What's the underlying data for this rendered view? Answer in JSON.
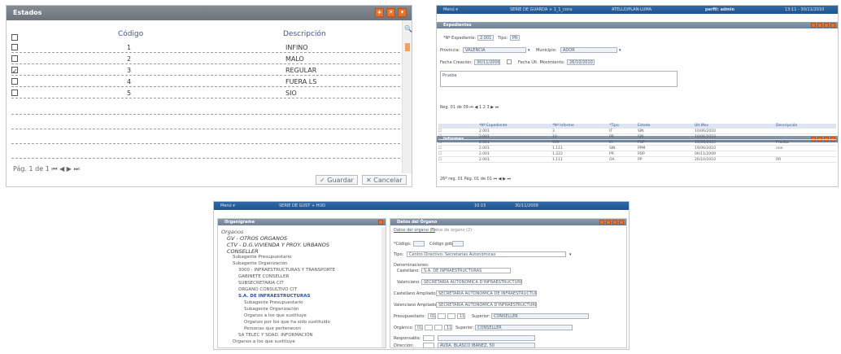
{
  "panel1": {
    "title": "Estados",
    "col_code": "Código",
    "col_desc": "Descripción",
    "rows": [
      {
        "code": "1",
        "desc": "INFINO",
        "checked": false
      },
      {
        "code": "2",
        "desc": "MALO",
        "checked": false
      },
      {
        "code": "3",
        "desc": "REGULAR",
        "checked": true
      },
      {
        "code": "4",
        "desc": "FUERA LS",
        "checked": false
      },
      {
        "code": "5",
        "desc": "SIO",
        "checked": false
      }
    ],
    "pager": "Pág. 1 de 1  ⏮ ◀ ▶ ⏭",
    "save_label": "✓ Guardar",
    "cancel_label": "✕ Cancelar"
  },
  "panel2": {
    "menu": "Menú ▾",
    "topbar_center": "SERIE DE GUARDA + 1_1_cons",
    "topbar_user": "ATELLO/PLAN-LUMA",
    "topbar_profile": "perfil: admin",
    "topbar_time": "13:11 - 30/11/2010",
    "section1": "Expedientes",
    "num_exp_label": "*Nº Expediente:",
    "num_exp_value": "2.001",
    "tipo_label": "Tipo:",
    "tipo_value": "PR",
    "provincia_label": "Provincia:",
    "provincia_value": "VALENCIA",
    "municipio_label": "Municipio:",
    "municipio_value": "ADOR",
    "fecha_creacion_label": "Fecha Creación:",
    "fecha_creacion_value": "30/11/2009",
    "fecha_ult_label": "Fecha Últ. Movimiento:",
    "fecha_ult_value": "26/10/2010",
    "obs_value": "Prueba",
    "pager1": "Reg. 01 de 09  ⏮ ◀ 1 2 3 ▶ ⏭",
    "section2": "Informes",
    "tbl_cols": [
      "*Nº Expediente",
      "*Nº Informe",
      "*Tipo",
      "Estado",
      "Últ.Mov",
      "Descripción"
    ],
    "tbl_rows": [
      [
        "2.001",
        "3",
        "IT",
        "SIN",
        "10/06/2010",
        ""
      ],
      [
        "2.001",
        "10",
        "PR",
        "SIN",
        "10/06/2010",
        ""
      ],
      [
        "2.001",
        "999",
        "IA",
        "PUP",
        "10/06/2010",
        "Prueba"
      ],
      [
        "2.001",
        "1.111",
        "SIN",
        "PPM",
        "19/06/2010",
        "nnn"
      ],
      [
        "2.001",
        "1.222",
        "PR",
        "PDP",
        "06/11/2009",
        ""
      ],
      [
        "2.001",
        "1.111",
        "OA",
        "PP",
        "26/10/2010",
        "RR"
      ]
    ],
    "pager2": "26º reg. 01 Pág. 01 de 01  ⏮ ◀ ▶ ⏭"
  },
  "panel3": {
    "menu": "Menú ▾",
    "topbar_center": "SERIE DE GUST + HUD",
    "topbar_time": "10:15",
    "topbar_date": "30/11/2009",
    "left_title": "Organigrama",
    "tree": [
      {
        "text": "Organos",
        "level": 0,
        "bold": false
      },
      {
        "text": "GV - OTROS ORGANOS",
        "level": 1,
        "bold": true
      },
      {
        "text": "CTV - D.G.VIVIENDA Y PROY. URBANOS",
        "level": 1,
        "bold": true
      },
      {
        "text": "CONSELLER",
        "level": 1,
        "bold": true
      },
      {
        "text": "Subagente Presupuestario",
        "level": 2,
        "bold": false
      },
      {
        "text": "Subagente Organización",
        "level": 2,
        "bold": false
      },
      {
        "text": "3000 - INFRAESTRUCTURAS Y TRANSPORTE",
        "level": 3,
        "bold": false
      },
      {
        "text": "GABINETE CONSELLER",
        "level": 3,
        "bold": false
      },
      {
        "text": "SUBSECRETARIA CIT",
        "level": 3,
        "bold": false
      },
      {
        "text": "ORGANO CONSULTIVO CIT",
        "level": 3,
        "bold": false
      },
      {
        "text": "S.A. DE INFRAESTRUCTURAS",
        "level": 3,
        "bold": true
      },
      {
        "text": "Subagente Presupuestario",
        "level": 4,
        "bold": false
      },
      {
        "text": "Subagente Organización",
        "level": 4,
        "bold": false
      },
      {
        "text": "Organos a los que sustituye",
        "level": 4,
        "bold": false
      },
      {
        "text": "Organos por los que ha sido sustituido",
        "level": 4,
        "bold": false
      },
      {
        "text": "Personas que pertenecen",
        "level": 4,
        "bold": false
      },
      {
        "text": "SA TELEC Y SDAD. INFORMACIÓN",
        "level": 3,
        "bold": false
      },
      {
        "text": "Organos a los que sustituye",
        "level": 2,
        "bold": false
      }
    ],
    "right_title": "Datos del Órgano",
    "tab1": "Datos del órgano (*)",
    "tab2": "Datos de órgano (2)",
    "codigo_label": "*Código:",
    "codigo_gob_label": "Código gob:",
    "tipo_label": "Tipo:",
    "tipo_value": "Centro Directivo: Secretarías Autonómicas",
    "denominaciones_label": "Denominaciones:",
    "castellano_label": "Castellano:",
    "castellano_value": "S.A. DE INFRAESTRUCTURAS",
    "valenciano_label": "Valenciano:",
    "valenciano_value": "SECRETARIA AUTONÓMICA D'INFRAESTRUCTURES",
    "cast_ampliado_label": "Castellano Ampliado:",
    "cast_ampliado_value": "SECRETARIA AUTONÓMICA DE INFRAESTRUCTURAS",
    "val_ampliado_label": "Valenciano Ampliado:",
    "val_ampliado_value": "SECRETARIA AUTONÓMICA D'INFRAESTRUCTURES",
    "presupuestario_label": "Presupuestario:",
    "presupuestario_values": [
      "01",
      "",
      "",
      "11"
    ],
    "superior_label": "Superior:",
    "superior_value": "CONSELLER",
    "organico_label": "Orgánico:",
    "organico_values": [
      "01",
      "",
      "",
      "11"
    ],
    "superior2_value": "CONSELLER",
    "responsable_label": "Responsable:",
    "direccion_label": "Dirección:",
    "direccion_value": "AVDA. BLASCO IBAÑEZ, 50"
  },
  "colors": {
    "accent_orange": "#e8722a",
    "topbar_blue": "#1f5590",
    "header_gray": "#6e747b"
  }
}
